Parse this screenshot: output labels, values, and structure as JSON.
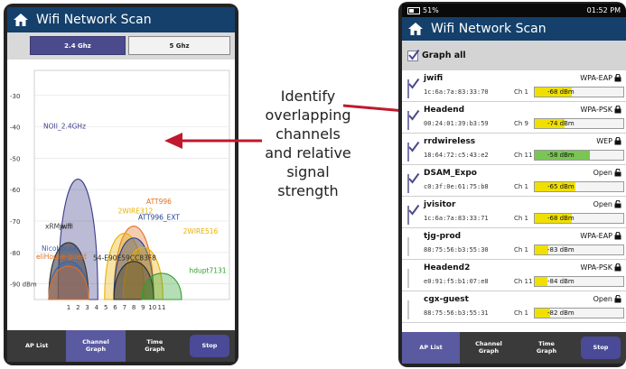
{
  "app": {
    "title": "Wifi Network Scan"
  },
  "left_screen": {
    "bands": [
      "2.4 Ghz",
      "5 Ghz"
    ],
    "selected_band": "2.4 Ghz",
    "nav": [
      "AP List",
      "Channel\nGraph",
      "Time\nGraph",
      "Stop"
    ],
    "active_nav": "Channel\nGraph"
  },
  "chart_data": {
    "type": "area",
    "title": "",
    "xlabel": "",
    "ylabel": "",
    "x_ticks": [
      "1",
      "2",
      "3",
      "4",
      "5",
      "6",
      "7",
      "8",
      "9",
      "10",
      "11"
    ],
    "y_ticks": [
      "-30",
      "-40",
      "-50",
      "-60",
      "-70",
      "-80",
      "-90 dBm"
    ],
    "ylim": [
      -95,
      -22
    ],
    "grid": true,
    "series": [
      {
        "name": "NOII_2.4GHz",
        "channel": 2,
        "dbm": -45,
        "color": "#3d3d8a"
      },
      {
        "name": "xRMwifi",
        "channel": 1,
        "dbm": -72,
        "color": "#3b3b3b"
      },
      {
        "name": "jwifi",
        "channel": 1,
        "dbm": -72,
        "color": "#3b3b3b"
      },
      {
        "name": "NicoHouse",
        "channel": 1,
        "dbm": -80,
        "color": "#3a64b0"
      },
      {
        "name": "eliHouse-guest",
        "channel": 1,
        "dbm": -82,
        "color": "#e07020"
      },
      {
        "name": "ATT996",
        "channel": 8,
        "dbm": -65,
        "color": "#e07020"
      },
      {
        "name": "2WIRE312",
        "channel": 7,
        "dbm": -68,
        "color": "#e8b000"
      },
      {
        "name": "ATT996_EXT",
        "channel": 8,
        "dbm": -70,
        "color": "#1e3f8f"
      },
      {
        "name": "2WIRE516",
        "channel": 9,
        "dbm": -74,
        "color": "#e8b000"
      },
      {
        "name": "54-E90E59CC83F8",
        "channel": 8,
        "dbm": -80,
        "color": "#2a2a2a"
      },
      {
        "name": "hdupt7131",
        "channel": 11,
        "dbm": -85,
        "color": "#2da02d"
      }
    ]
  },
  "right_screen": {
    "status": {
      "battery": "51%",
      "time": "01:52 PM"
    },
    "graph_all_label": "Graph all",
    "graph_all_checked": true,
    "networks": [
      {
        "name": "jwifi",
        "mac": "1c:6a:7a:83:33:70",
        "security": "WPA-EAP",
        "locked": true,
        "channel": "Ch 1",
        "signal": "-68 dBm",
        "strength": 0.42,
        "bar_color": "#f0e000",
        "checked": true
      },
      {
        "name": "Headend",
        "mac": "00:24:01:39:b3:59",
        "security": "WPA-PSK",
        "locked": true,
        "channel": "Ch 9",
        "signal": "-74 dBm",
        "strength": 0.34,
        "bar_color": "#f0e000",
        "checked": true
      },
      {
        "name": "rrdwireless",
        "mac": "18:64:72:c5:43:e2",
        "security": "WEP",
        "locked": true,
        "channel": "Ch 11",
        "signal": "-58 dBm",
        "strength": 0.62,
        "bar_color": "#7ac553",
        "checked": true
      },
      {
        "name": "DSAM_Expo",
        "mac": "c0:3f:0e:61:75:b8",
        "security": "Open",
        "locked": false,
        "channel": "Ch 1",
        "signal": "-65 dBm",
        "strength": 0.46,
        "bar_color": "#f0e000",
        "checked": true
      },
      {
        "name": "jvisitor",
        "mac": "1c:6a:7a:83:33:71",
        "security": "Open",
        "locked": false,
        "channel": "Ch 1",
        "signal": "-68 dBm",
        "strength": 0.42,
        "bar_color": "#f0e000",
        "checked": true
      },
      {
        "name": "tjg-prod",
        "mac": "88:75:56:b3:55:30",
        "security": "WPA-EAP",
        "locked": true,
        "channel": "Ch 1",
        "signal": "-83 dBm",
        "strength": 0.15,
        "bar_color": "#f0e000",
        "checked": false
      },
      {
        "name": "Headend2",
        "mac": "e0:91:f5:b1:07:e8",
        "security": "WPA-PSK",
        "locked": true,
        "channel": "Ch 11",
        "signal": "-84 dBm",
        "strength": 0.14,
        "bar_color": "#f0e000",
        "checked": false
      },
      {
        "name": "cgx-guest",
        "mac": "88:75:56:b3:55:31",
        "security": "Open",
        "locked": false,
        "channel": "Ch 1",
        "signal": "-82 dBm",
        "strength": 0.17,
        "bar_color": "#f0e000",
        "checked": false
      }
    ],
    "nav": [
      "AP List",
      "Channel\nGraph",
      "Time\nGraph",
      "Stop"
    ]
  },
  "callout": {
    "text": "Identify overlapping channels and relative signal strength"
  },
  "colors": {
    "header": "#14406b",
    "arrow": "#c0192d",
    "nav_active": "#5a5aa0"
  },
  "icons": {
    "home": "home-icon",
    "lock": "lock-icon",
    "unlock": "unlock-icon",
    "check": "checkmark-icon",
    "battery": "battery-icon"
  }
}
